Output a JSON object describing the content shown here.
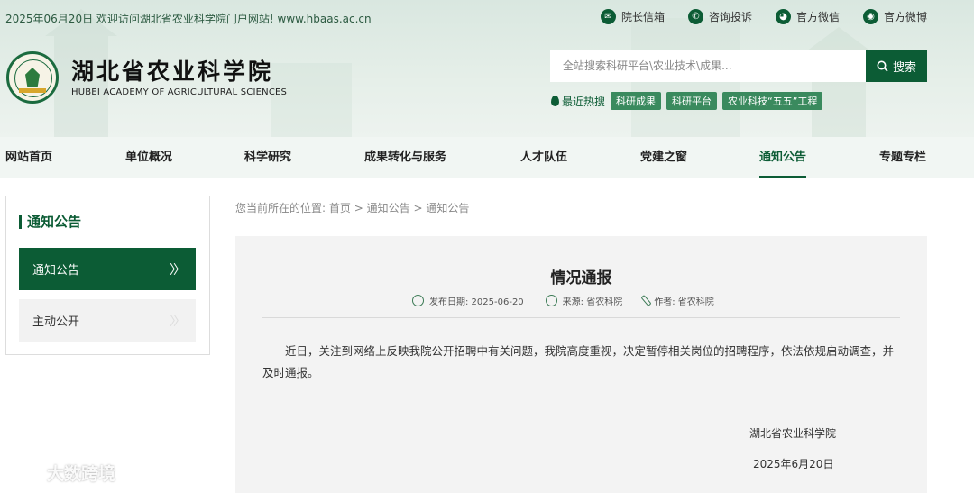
{
  "header": {
    "welcome": "2025年06月20日 欢迎访问湖北省农业科学院门户网站! www.hbaas.ac.cn",
    "top_links": [
      {
        "label": "院长信箱",
        "icon": "mail-icon",
        "glyph": "✉"
      },
      {
        "label": "咨询投诉",
        "icon": "phone-icon",
        "glyph": "✆"
      },
      {
        "label": "官方微信",
        "icon": "wechat-icon",
        "glyph": "◕"
      },
      {
        "label": "官方微博",
        "icon": "weibo-icon",
        "glyph": "◉"
      }
    ],
    "org_cn": "湖北省农业科学院",
    "org_en": "HUBEI ACADEMY OF AGRICULTURAL SCIENCES",
    "search": {
      "placeholder": "全站搜索科研平台\\农业技术\\成果...",
      "button": "搜索"
    },
    "hot": {
      "label": "最近热搜",
      "tags": [
        "科研成果",
        "科研平台",
        "农业科技“五五”工程"
      ]
    }
  },
  "nav": {
    "items": [
      "网站首页",
      "单位概况",
      "科学研究",
      "成果转化与服务",
      "人才队伍",
      "党建之窗",
      "通知公告",
      "专题专栏"
    ],
    "active": "通知公告"
  },
  "sidebar": {
    "title": "通知公告",
    "items": [
      {
        "label": "通知公告"
      },
      {
        "label": "主动公开"
      }
    ]
  },
  "breadcrumb": {
    "prefix": "您当前所在的位置:",
    "home": "首页",
    "sep": ">",
    "level1": "通知公告",
    "level2": "通知公告"
  },
  "article": {
    "title": "情况通报",
    "publish": "发布日期: 2025-06-20",
    "source": "来源: 省农科院",
    "author": "作者: 省农科院",
    "body": "近日，关注到网络上反映我院公开招聘中有关问题，我院高度重视，决定暂停相关岗位的招聘程序，依法依规启动调查，并及时通报。",
    "signature": "湖北省农业科学院",
    "date": "2025年6月20日"
  },
  "watermark": "大数跨境",
  "colors": {
    "brand": "#0c5c35",
    "tag": "#3a8a5e"
  }
}
